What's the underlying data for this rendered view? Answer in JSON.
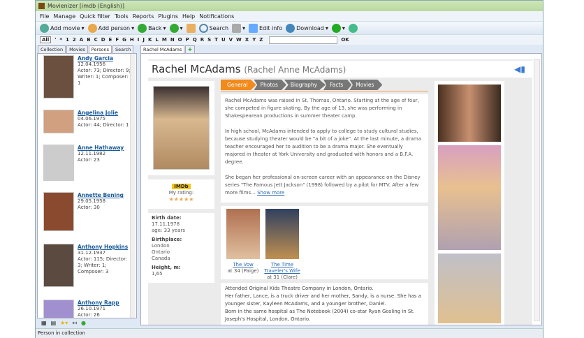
{
  "window": {
    "title": "Movienizer [imdb (English)]"
  },
  "menu": [
    "File",
    "Manage",
    "Quick filter",
    "Tools",
    "Reports",
    "Plugins",
    "Help",
    "Notifications"
  ],
  "toolbar": {
    "add_movie": "Add movie",
    "add_person": "Add person",
    "back": "Back",
    "search": "Search",
    "edit_info": "Edit info",
    "download": "Download"
  },
  "alphabet": [
    "All",
    "'",
    "*",
    "1",
    "2",
    "A",
    "B",
    "C",
    "D",
    "E",
    "F",
    "G",
    "H",
    "I",
    "J",
    "K",
    "L",
    "M",
    "N",
    "O",
    "P",
    "Q",
    "R",
    "S",
    "T",
    "U",
    "V",
    "W",
    "X",
    "Y",
    "Z"
  ],
  "alpha_ok": "OK",
  "left_tabs": [
    "Collection",
    "Movies",
    "Persons",
    "Search"
  ],
  "doc_tab": "Rachel McAdams",
  "persons": [
    {
      "name": "Andy Garcia",
      "info": "12.04.1956\nActor: 73; Director: 9; Writer: 1; Composer: 1"
    },
    {
      "name": "Angelina Jolie",
      "info": "04.06.1975\nActor: 44; Director: 1"
    },
    {
      "name": "Anne Hathaway",
      "info": "12.11.1982\nActor: 23"
    },
    {
      "name": "Annette Bening",
      "info": "29.05.1958\nActor: 30"
    },
    {
      "name": "Anthony Hopkins",
      "info": "31.12.1937\nActor: 115; Director: 3; Writer: 1; Composer: 3"
    },
    {
      "name": "Anthony Rapp",
      "info": "26.10.1971\nActor: 26"
    }
  ],
  "status": "Person in collection",
  "person": {
    "name": "Rachel McAdams",
    "full_name": "(Rachel Anne McAdams)",
    "tabs": [
      "General",
      "Photos",
      "Biography",
      "Facts",
      "Movies"
    ],
    "bio": [
      "Rachel McAdams was raised in St. Thomas, Ontario. Starting at the age of four, she competed in figure skating. By the age of 13, she was performing in Shakespearean productions in summer theater camp.",
      "In high school, McAdams intended to apply to college to study cultural studies, because studying theater would be \"a bit of a joke\". At the last minute, a drama teacher encouraged her to audition to be a drama major. She eventually majored in theater at York University and graduated with honors and a B.F.A. degree.",
      "She began her professional on-screen career with an appearance on the Disney series \"The Famous Jett Jackson\" (1998) followed by a pilot for MTV. After a few more films..."
    ],
    "show_more": "Show more",
    "imdb": "IMDb",
    "rating_label": "My rating:",
    "rating": "★★★★★",
    "birth_label": "Birth date:",
    "birth": "17.11.1978",
    "age": "age: 33 years",
    "birthplace_label": "Birthplace:",
    "birthplace": [
      "London",
      "Ontario",
      "Canada"
    ],
    "height_label": "Height, m:",
    "height": "1,65",
    "movies": [
      {
        "title": "The Vow",
        "role": "at 34 (Paige)"
      },
      {
        "title": "The Time Traveler's Wife",
        "role": "at 31 (Clare)"
      }
    ],
    "facts": [
      "Attended Original Kids Theatre Company in London, Ontario.",
      "Her father, Lance, is a truck driver and her mother, Sandy, is a nurse. She has a younger sister, Kayleen McAdams, and a younger brother, Daniel.",
      "Born in the same hospital as The Notebook (2004) co-star Ryan Gosling in St. Joseph's Hospital, London, Ontario."
    ]
  }
}
